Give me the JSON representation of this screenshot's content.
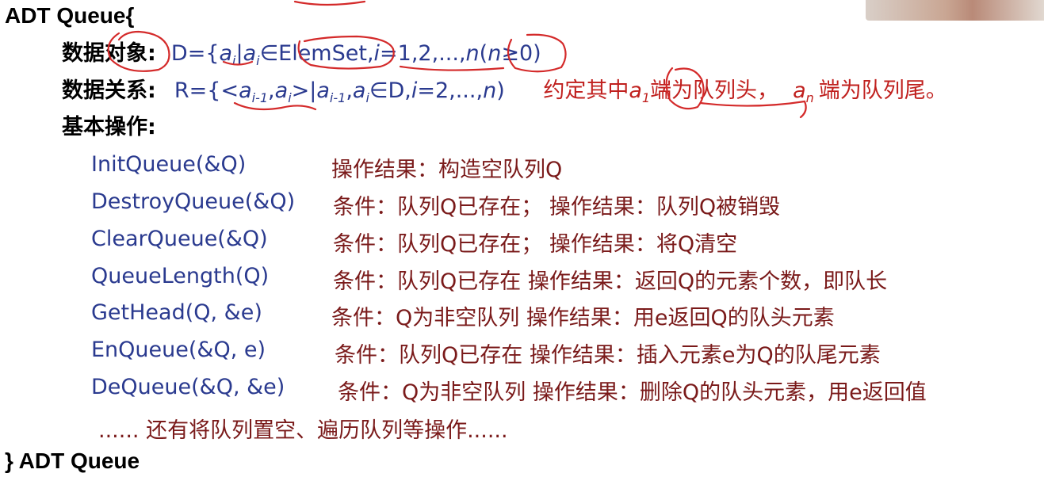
{
  "header": {
    "adt_open": "ADT  Queue{",
    "adt_close": "} ADT Queue"
  },
  "data_object": {
    "label": "数据对象:",
    "expr_prefix": "D={",
    "a": "a",
    "sub_i": "i",
    "mid1": "|",
    "member": "∈ElemSet,",
    "i": "i",
    "eq": "=1,2,...,",
    "n": "n",
    "paren_open": "(",
    "cond": "≥0)"
  },
  "data_relation": {
    "label": "数据关系:",
    "expr_prefix": "R={<",
    "a": "a",
    "sub_i1": "i-1",
    "comma": ",",
    "sub_i": "i",
    "close_angle": ">|",
    "member": "∈D,",
    "i": "i",
    "eq": "=2,...,",
    "n": "n",
    "close": ")",
    "note_part1": "约定其中",
    "note_sub1": "1",
    "note_part2": "端为队列头，",
    "note_sub_n": "n",
    "note_part3": "端为队列尾。"
  },
  "basic_ops_label": "基本操作:",
  "operations": [
    {
      "name": "InitQueue(&Q)",
      "desc": "操作结果：构造空队列Q"
    },
    {
      "name": "DestroyQueue(&Q)",
      "desc": "条件：队列Q已存在；  操作结果：队列Q被销毁"
    },
    {
      "name": "ClearQueue(&Q)",
      "desc": "条件：队列Q已存在；  操作结果：将Q清空"
    },
    {
      "name": "QueueLength(Q)",
      "desc": "条件：队列Q已存在      操作结果：返回Q的元素个数，即队长"
    },
    {
      "name": "GetHead(Q, &e)",
      "desc": "条件：Q为非空队列      操作结果：用e返回Q的队头元素"
    },
    {
      "name": "EnQueue(&Q, e)",
      "desc": "条件：队列Q已存在      操作结果：插入元素e为Q的队尾元素"
    },
    {
      "name": "DeQueue(&Q, &e)",
      "desc": "条件：Q为非空队列      操作结果：删除Q的队头元素，用e返回值"
    }
  ],
  "more_ops": "......  还有将队列置空、遍历队列等操作......",
  "colors": {
    "function_blue": "#2a3a8f",
    "desc_darkred": "#7a1a1a",
    "note_red": "#c0201e",
    "ink_red": "#d42a2a"
  }
}
